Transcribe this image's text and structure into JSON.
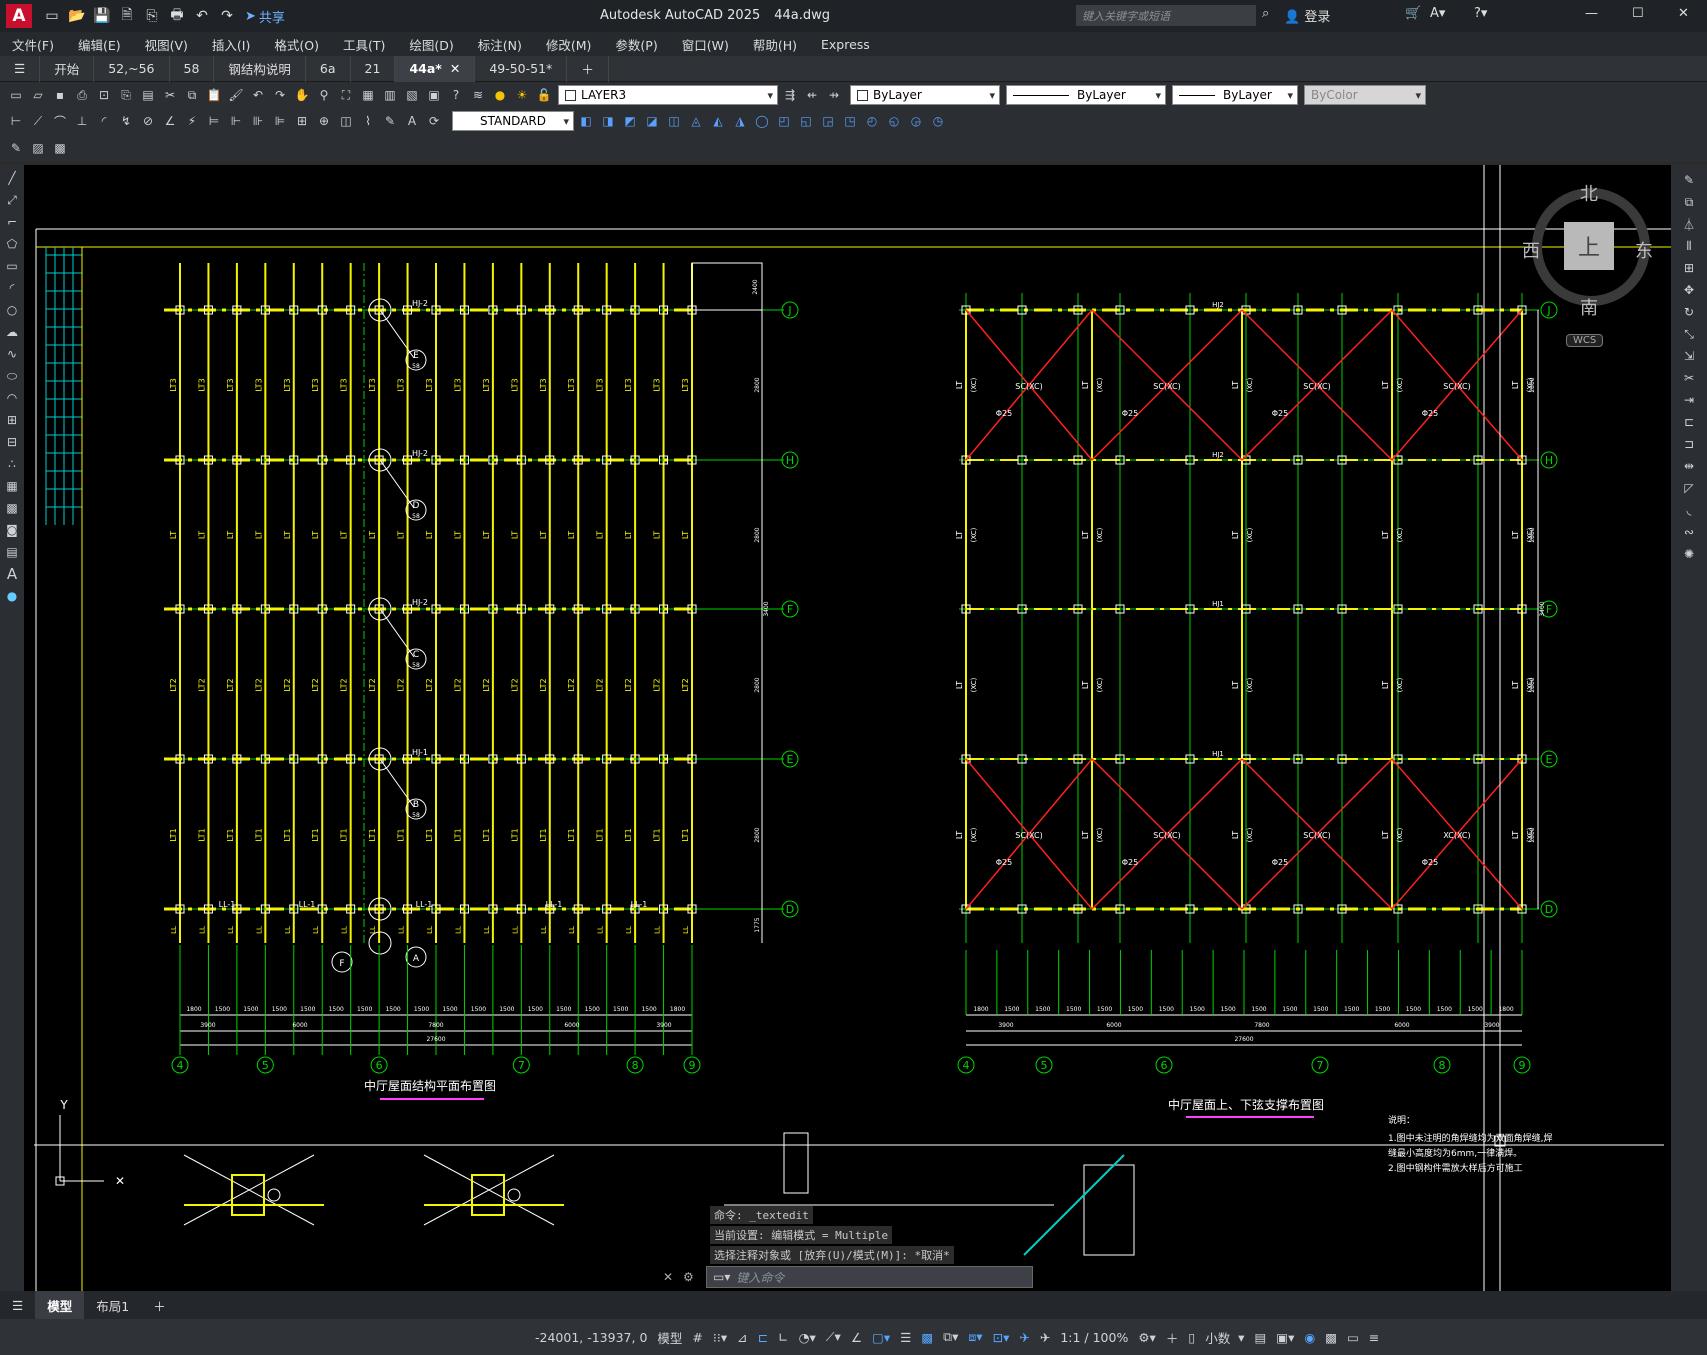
{
  "app": {
    "title": "Autodesk AutoCAD 2025",
    "file": "44a.dwg",
    "share": "共享",
    "search_placeholder": "键入关键字或短语",
    "login": "登录"
  },
  "menu": [
    "文件(F)",
    "编辑(E)",
    "视图(V)",
    "插入(I)",
    "格式(O)",
    "工具(T)",
    "绘图(D)",
    "标注(N)",
    "修改(M)",
    "参数(P)",
    "窗口(W)",
    "帮助(H)",
    "Express"
  ],
  "tabs": [
    {
      "label": "开始"
    },
    {
      "label": "52,~56"
    },
    {
      "label": "58"
    },
    {
      "label": "钢结构说明"
    },
    {
      "label": "6a"
    },
    {
      "label": "21"
    },
    {
      "label": "44a*"
    },
    {
      "label": "49-50-51*"
    }
  ],
  "toolbar": {
    "layer": "LAYER3",
    "color": "ByLayer",
    "linetype": "ByLayer",
    "lineweight": "ByLayer",
    "plotstyle": "ByColor",
    "textstyle": "STANDARD"
  },
  "drawing": {
    "plan_title": "中厅屋面结构平面布置图",
    "bracing_title": "中厅屋面上、下弦支撑布置图",
    "axes_rows": [
      "J",
      "H",
      "F",
      "E",
      "D"
    ],
    "axes_cols": [
      "4",
      "5",
      "6",
      "7",
      "8",
      "9"
    ],
    "beam_labels": {
      "lt3": "LT3",
      "lt": "LT",
      "lt2": "LT2",
      "lt1": "LT1",
      "ll1": "LL-1",
      "hj2": "HJ-2",
      "hj1": "HJ-1",
      "hj2b": "HJ2",
      "hj1b": "HJ1",
      "sc": "SC(XC)",
      "xc": "XC(XC)",
      "phi": "Φ25",
      "xc2": "(XC)"
    },
    "bubble_labels": [
      "E",
      "D",
      "C",
      "B",
      "A",
      "F"
    ],
    "bubble_sub": "58",
    "dims_bottom": [
      "1800",
      "1500",
      "1500",
      "1500",
      "1500",
      "1500",
      "1500",
      "1500",
      "1500",
      "1500",
      "1500",
      "1500",
      "1500",
      "1500",
      "1500",
      "1500",
      "1500",
      "1800"
    ],
    "dims_mid": [
      "3900",
      "6000",
      "7800",
      "6000",
      "3900"
    ],
    "dim_total": "27600",
    "dims_right": [
      "2800",
      "2800",
      "2800",
      "2800",
      "1775"
    ],
    "dim_span": "3400",
    "dim_top": "2400",
    "notes_title": "说明：",
    "notes": [
      "1.图中未注明的角焊缝均为双面角焊缝,焊",
      "  缝最小高度均为6mm,一律满焊。",
      "2.图中钢构件需放大样后方可施工"
    ],
    "viewcube": {
      "n": "北",
      "s": "南",
      "e": "东",
      "w": "西",
      "top": "上",
      "wcs": "WCS"
    },
    "ucs_y": "Y"
  },
  "command": {
    "lines": [
      "命令:  _textedit",
      "当前设置: 编辑模式 = Multiple",
      "选择注释对象或 [放弃(U)/模式(M)]: *取消*"
    ],
    "placeholder": "键入命令"
  },
  "layout_tabs": [
    "模型",
    "布局1"
  ],
  "status": {
    "coords": "-24001, -13937, 0",
    "space": "模型",
    "scale": "1:1 / 100%",
    "units": "小数"
  }
}
